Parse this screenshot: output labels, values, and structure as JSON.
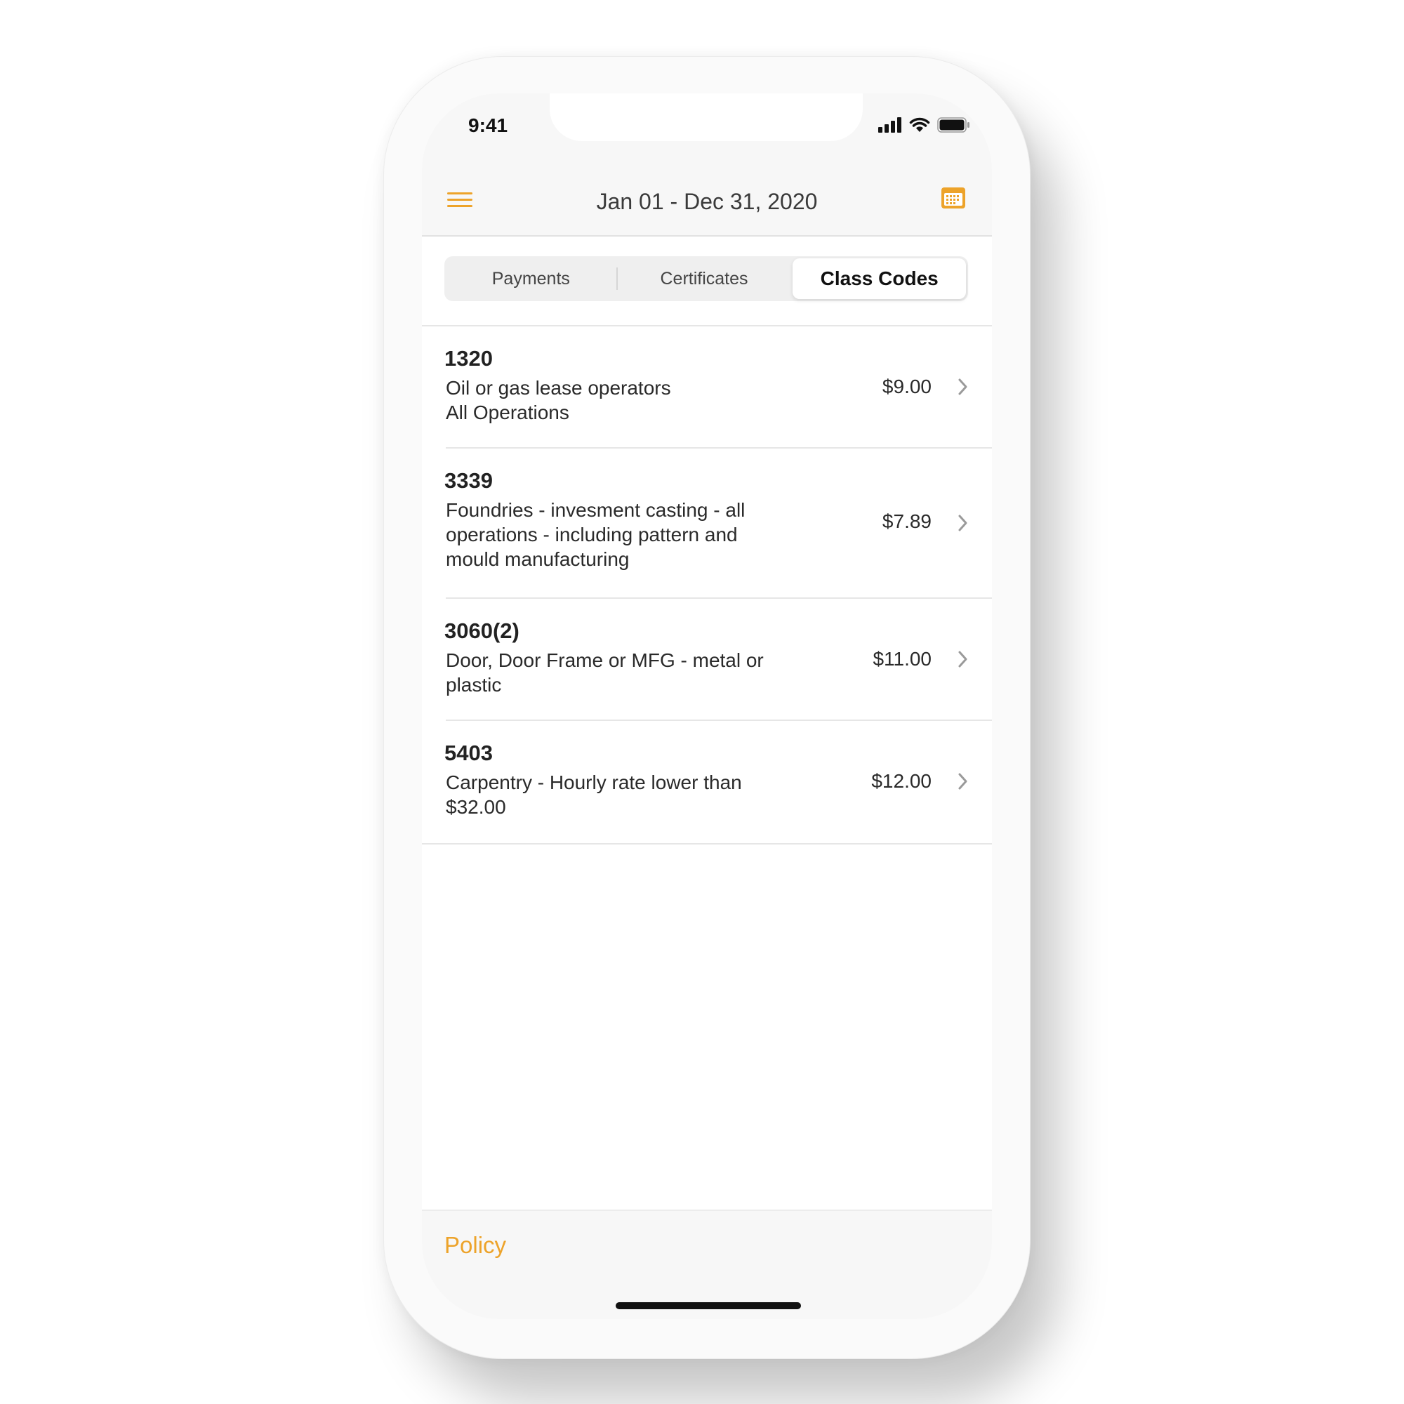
{
  "status_bar": {
    "time": "9:41",
    "icons": [
      "cellular-signal-icon",
      "wifi-icon",
      "battery-icon"
    ]
  },
  "header": {
    "title": "Jan 01 - Dec 31, 2020",
    "menu_icon": "hamburger-menu-icon",
    "calendar_icon": "calendar-icon",
    "accent_color": "#eda32a"
  },
  "tabs": [
    {
      "label": "Payments",
      "active": false
    },
    {
      "label": "Certificates",
      "active": false
    },
    {
      "label": "Class Codes",
      "active": true
    }
  ],
  "class_codes": [
    {
      "code": "1320",
      "description_lines": [
        "Oil or gas lease operators",
        "All Operations"
      ],
      "price": "$9.00"
    },
    {
      "code": "3339",
      "description_lines": [
        "Foundries - invesment casting - all",
        "operations - including pattern and",
        "mould manufacturing"
      ],
      "price": "$7.89"
    },
    {
      "code": "3060(2)",
      "description_lines": [
        "Door, Door Frame or MFG - metal or",
        "plastic"
      ],
      "price": "$11.00"
    },
    {
      "code": "5403",
      "description_lines": [
        "Carpentry - Hourly rate lower than",
        "$32.00"
      ],
      "price": "$12.00"
    }
  ],
  "footer": {
    "policy_label": "Policy"
  }
}
